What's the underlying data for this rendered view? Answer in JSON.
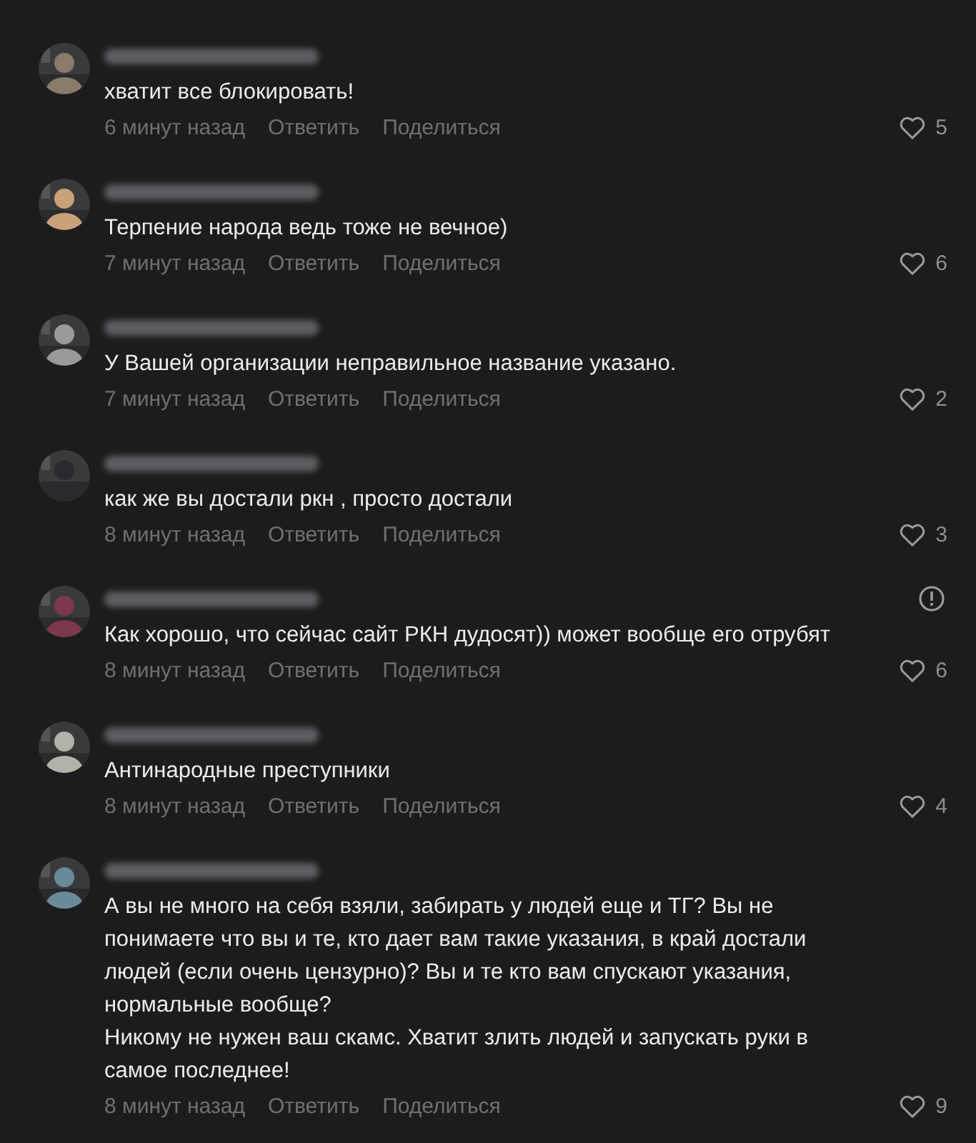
{
  "comments": [
    {
      "text": "хватит все блокировать!",
      "time": "6 минут назад",
      "reply": "Ответить",
      "share": "Поделиться",
      "likes": "5",
      "reportable": false
    },
    {
      "text": "Терпение народа ведь тоже не вечное)",
      "time": "7 минут назад",
      "reply": "Ответить",
      "share": "Поделиться",
      "likes": "6",
      "reportable": false
    },
    {
      "text": "У Вашей организации неправильное название указано.",
      "time": "7 минут назад",
      "reply": "Ответить",
      "share": "Поделиться",
      "likes": "2",
      "reportable": false
    },
    {
      "text": "как же вы достали ркн , просто достали",
      "time": "8 минут назад",
      "reply": "Ответить",
      "share": "Поделиться",
      "likes": "3",
      "reportable": false
    },
    {
      "text": "Как хорошо, что сейчас сайт РКН дудосят)) может вообще его отрубят",
      "time": "8 минут назад",
      "reply": "Ответить",
      "share": "Поделиться",
      "likes": "6",
      "reportable": true
    },
    {
      "text": "Антинародные преступники",
      "time": "8 минут назад",
      "reply": "Ответить",
      "share": "Поделиться",
      "likes": "4",
      "reportable": false
    },
    {
      "text": "А вы не много на себя взяли, забирать у людей еще и ТГ? Вы не\nпонимаете что вы и те, кто дает вам такие указания, в край достали\nлюдей (если очень цензурно)? Вы и те кто вам спускают указания,\nнормальные вообще?\nНикому не нужен ваш скамс. Хватит злить людей и запускать руки в\nсамое последнее!",
      "time": "8 минут назад",
      "reply": "Ответить",
      "share": "Поделиться",
      "likes": "9",
      "reportable": false
    }
  ]
}
